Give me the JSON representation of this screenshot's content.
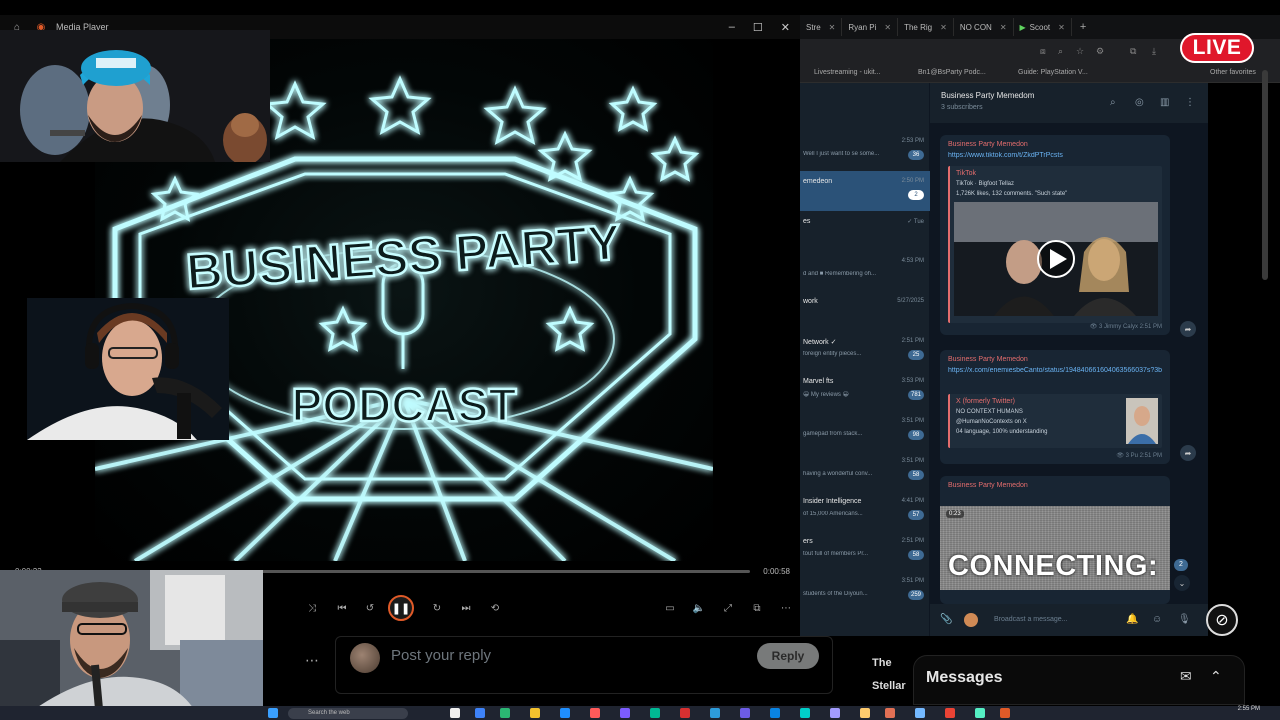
{
  "player": {
    "title": "Media Player",
    "time_current": "0:00:23",
    "time_total": "0:00:58",
    "progress_fraction": 0.06,
    "video_top_text": "BUSINESS PARTY",
    "video_bottom_text": "PODCAST"
  },
  "browser": {
    "tabs": [
      {
        "label": "Stre"
      },
      {
        "label": "Ryan Pi"
      },
      {
        "label": "The Rig"
      },
      {
        "label": "NO CON"
      },
      {
        "label": "Scoot"
      }
    ],
    "bookmarks": [
      "Livestreaming - ukit...",
      "Bn1@BsParty Podc...",
      "Guide: PlayStation V...",
      "Other favorites"
    ],
    "live_label": "LIVE"
  },
  "telegram": {
    "chat_list": [
      {
        "name": "",
        "time": "2:53 PM",
        "preview": "Well I just want to se some...",
        "badge": "36",
        "active": false
      },
      {
        "name": "emedeon",
        "time": "2:50 PM",
        "preview": "",
        "badge": "2",
        "active": true
      },
      {
        "name": "es",
        "time": "✓ Tue",
        "preview": "",
        "badge": "",
        "active": false
      },
      {
        "name": "",
        "time": "4:53 PM",
        "preview": "d and ■ Remembering oh...",
        "badge": "",
        "active": false
      },
      {
        "name": "work",
        "time": "5/27/2025",
        "preview": "",
        "badge": "",
        "active": false
      },
      {
        "name": "Network ✓",
        "time": "2:51 PM",
        "preview": "foreign entity pieces...",
        "badge": "25",
        "active": false
      },
      {
        "name": "Marvel fts",
        "time": "3:53 PM",
        "preview": "😀 My reviews 😀",
        "badge": "781",
        "active": false
      },
      {
        "name": "",
        "time": "3:51 PM",
        "preview": "gamepad from stack...",
        "badge": "98",
        "active": false
      },
      {
        "name": "",
        "time": "3:51 PM",
        "preview": "having a wonderful conv...",
        "badge": "58",
        "active": false
      },
      {
        "name": "Insider Intelligence",
        "time": "4:41 PM",
        "preview": "of 15,000 Americans...",
        "badge": "57",
        "active": false
      },
      {
        "name": "ers",
        "time": "2:51 PM",
        "preview": "tout full of members Pr...",
        "badge": "58",
        "active": false
      },
      {
        "name": "",
        "time": "3:51 PM",
        "preview": "students of the Diyoun...",
        "badge": "259",
        "active": false
      }
    ],
    "chat_title": "Business Party Memedom",
    "chat_subtitle": "3 subscribers",
    "messages": [
      {
        "author": "Business Party Memedon",
        "link": "https://www.tiktok.com/t/ZkdPTrPcsts",
        "preview_title": "TikTok",
        "preview_line1": "TikTok · Bigfoot Tellaz",
        "preview_line2": "1,726K likes, 132 comments. \"Such state\"",
        "meta": "👁 3  Jimmy Calyx  2:51 PM"
      },
      {
        "author": "Business Party Memedon",
        "link": "https://x.com/enemiesbeCanto/status/194840661604063566037s?3bCoo, 4lleYST3lb0jdW-Q6w=10",
        "preview_title": "X (formerly Twitter)",
        "preview_line1": "NO CONTEXT HUMANS",
        "preview_line2": "@HumanNoContexts on X",
        "preview_line3": "04 language, 100% understanding",
        "meta": "👁 3  Pu  2:51 PM"
      },
      {
        "author": "Business Party Memedon",
        "video_duration": "0:23",
        "video_text": "CONNECTING:"
      }
    ],
    "compose_placeholder": "Broadcast a message...",
    "unread_badge": "2"
  },
  "reply": {
    "placeholder": "Post your reply",
    "button": "Reply",
    "side_text_1": "The",
    "side_text_2": "Stellar"
  },
  "messages_panel": {
    "title": "Messages"
  },
  "taskbar": {
    "search_placeholder": "Search the web",
    "clock": "2:55 PM"
  }
}
